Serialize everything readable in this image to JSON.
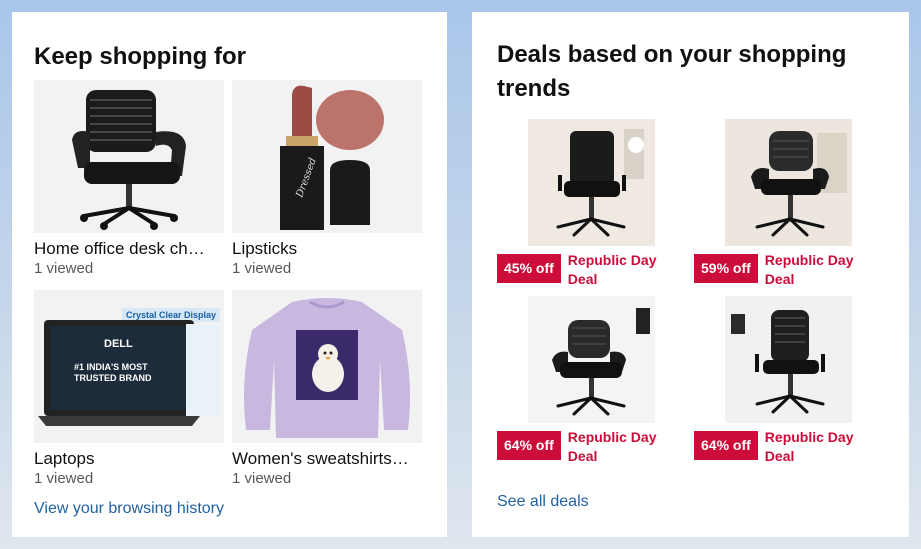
{
  "keep_shopping": {
    "title": "Keep shopping for",
    "tiles": [
      {
        "label": "Home office desk ch…",
        "sub": "1 viewed",
        "icon": "office-chair"
      },
      {
        "label": "Lipsticks",
        "sub": "1 viewed",
        "icon": "lipstick"
      },
      {
        "label": "Laptops",
        "sub": "1 viewed",
        "icon": "laptop",
        "banner": "Crystal Clear Display",
        "brand": "DELL",
        "tagline": "#1 INDIA'S MOST TRUSTED BRAND"
      },
      {
        "label": "Women's sweatshirts…",
        "sub": "1 viewed",
        "icon": "sweatshirt"
      }
    ],
    "history_link": "View your browsing history"
  },
  "deals": {
    "title": "Deals based on your shopping trends",
    "items": [
      {
        "discount": "45% off",
        "label": "Republic Day Deal",
        "icon": "office-chair"
      },
      {
        "discount": "59% off",
        "label": "Republic Day Deal",
        "icon": "office-chair"
      },
      {
        "discount": "64% off",
        "label": "Republic Day Deal",
        "icon": "office-chair"
      },
      {
        "discount": "64% off",
        "label": "Republic Day Deal",
        "icon": "office-chair"
      }
    ],
    "see_all": "See all deals"
  },
  "colors": {
    "deal_red": "#cc0c39",
    "link_blue": "#2162a1",
    "lipstick": "#b5655c",
    "sweatshirt": "#c8b8e0"
  }
}
